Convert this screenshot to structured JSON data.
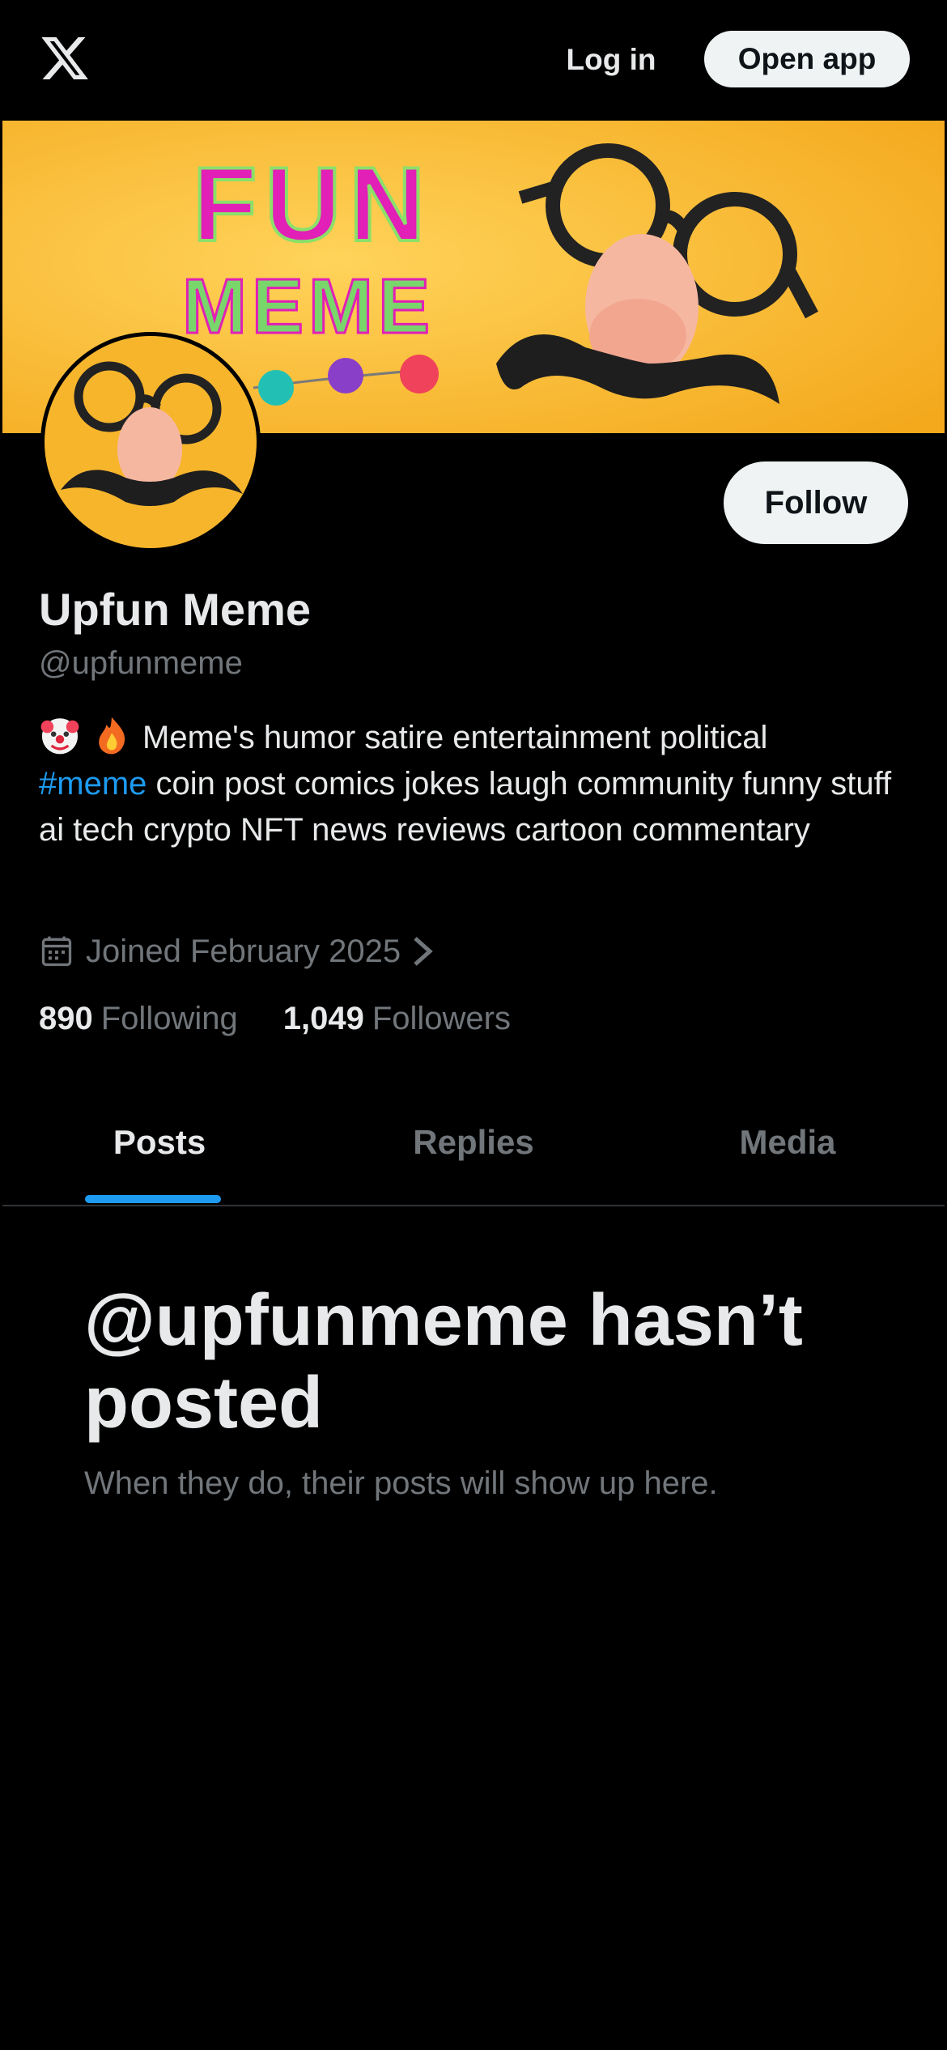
{
  "topbar": {
    "logo_icon": "x-logo-icon",
    "login_label": "Log in",
    "open_app_label": "Open app"
  },
  "banner": {
    "text_line1": "FUN",
    "text_line2": "MEME",
    "background_color": "#f7b52c"
  },
  "profile": {
    "follow_label": "Follow",
    "display_name": "Upfun Meme",
    "handle": "@upfunmeme",
    "bio_emojis": [
      "clown-face-emoji",
      "fire-emoji"
    ],
    "bio_text_1": "Meme's humor satire entertainment political",
    "bio_hashtag": "#meme",
    "bio_text_2": " coin post comics jokes laugh community funny stuff ai tech crypto NFT news reviews cartoon commentary",
    "joined": "Joined February 2025",
    "following_count": "890",
    "following_label": "Following",
    "followers_count": "1,049",
    "followers_label": "Followers"
  },
  "tabs": [
    {
      "label": "Posts",
      "active": true
    },
    {
      "label": "Replies",
      "active": false
    },
    {
      "label": "Media",
      "active": false
    }
  ],
  "empty_state": {
    "title": "@upfunmeme hasn’t posted",
    "subtitle": "When they do, their posts will show up here."
  },
  "colors": {
    "accent": "#1d9bf0",
    "background": "#000000",
    "text_primary": "#e7e9ea",
    "text_secondary": "#71767b"
  }
}
